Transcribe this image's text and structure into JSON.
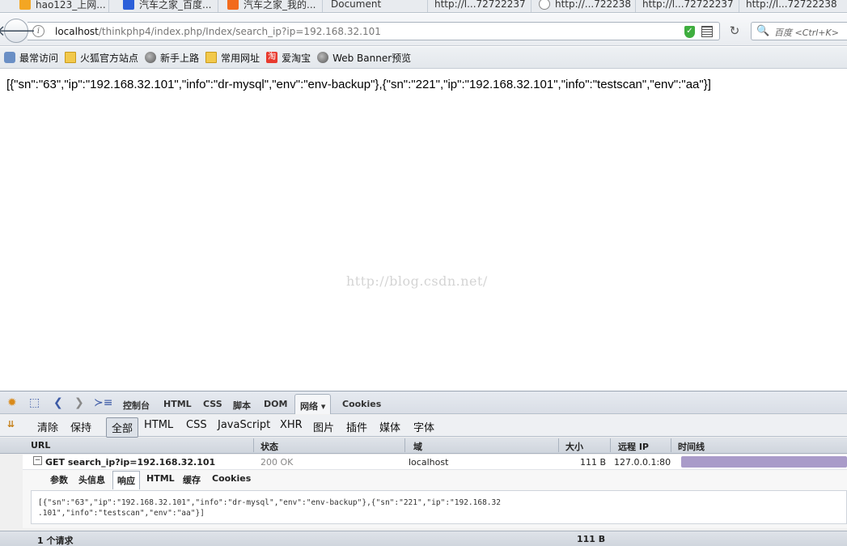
{
  "tabs": [
    {
      "label": "hao123_上网...",
      "icon": "hao123-icon",
      "color": "#f3a623"
    },
    {
      "label": "汽车之家_百度...",
      "icon": "baidu-paw-icon",
      "color": "#2b5fd9"
    },
    {
      "label": "汽车之家_我的...",
      "icon": "autohome-icon",
      "color": "#f26b1d"
    },
    {
      "label": "Document",
      "icon": "",
      "color": ""
    },
    {
      "label": "http://l...72722237",
      "icon": "",
      "color": ""
    },
    {
      "label": "http://...722238",
      "icon": "cloud-icon",
      "color": "#888888"
    },
    {
      "label": "http://l...72722237",
      "icon": "",
      "color": ""
    },
    {
      "label": "http://l...72722238",
      "icon": "",
      "color": ""
    }
  ],
  "nav": {
    "url_host": "localhost",
    "url_path": "/thinkphp4/index.php/Index/search_ip?ip=192.168.32.101",
    "search_placeholder": "百度 <Ctrl+K>"
  },
  "bookmarks": [
    {
      "label": "最常访问",
      "icon": "visited-icon"
    },
    {
      "label": "火狐官方站点",
      "icon": "folder-icon"
    },
    {
      "label": "新手上路",
      "icon": "globe-icon"
    },
    {
      "label": "常用网址",
      "icon": "folder-icon"
    },
    {
      "label": "爱淘宝",
      "icon": "taobao-icon"
    },
    {
      "label": "Web Banner预览",
      "icon": "globe-icon"
    }
  ],
  "page": {
    "json_output": "[{\"sn\":\"63\",\"ip\":\"192.168.32.101\",\"info\":\"dr-mysql\",\"env\":\"env-backup\"},{\"sn\":\"221\",\"ip\":\"192.168.32.101\",\"info\":\"testscan\",\"env\":\"aa\"}]",
    "watermark": "http://blog.csdn.net/"
  },
  "firebug": {
    "tabs": [
      "控制台",
      "HTML",
      "CSS",
      "脚本",
      "DOM",
      "网络 ▾",
      "Cookies"
    ],
    "filters": [
      "清除",
      "保持",
      "全部",
      "HTML",
      "CSS",
      "JavaScript",
      "XHR",
      "图片",
      "插件",
      "媒体",
      "字体"
    ],
    "columns": [
      "URL",
      "状态",
      "域",
      "大小",
      "远程 IP",
      "时间线"
    ],
    "request": {
      "url": "GET search_ip?ip=192.168.32.101",
      "status": "200 OK",
      "domain": "localhost",
      "size": "111 B",
      "remote_ip": "127.0.0.1:80"
    },
    "detail_tabs": [
      "参数",
      "头信息",
      "响应",
      "HTML",
      "缓存",
      "Cookies"
    ],
    "response_line1": "[{\"sn\":\"63\",\"ip\":\"192.168.32.101\",\"info\":\"dr-mysql\",\"env\":\"env-backup\"},{\"sn\":\"221\",\"ip\":\"192.168.32",
    "response_line2": ".101\",\"info\":\"testscan\",\"env\":\"aa\"}]",
    "status_count": "1 个请求",
    "status_size": "111 B"
  }
}
